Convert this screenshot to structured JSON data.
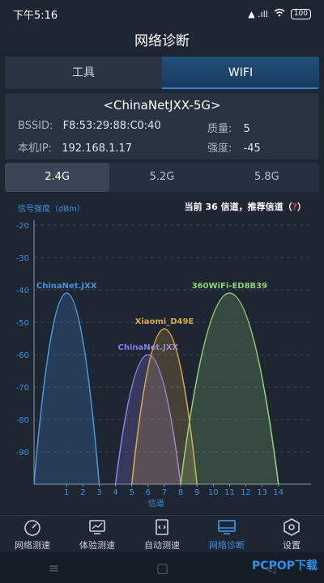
{
  "status_bar": {
    "time": "下午5:16",
    "signal": "▲ .ıll",
    "battery": "100"
  },
  "title": "网络诊断",
  "top_tabs": [
    "工具",
    "WIFI"
  ],
  "active_top_tab": 1,
  "network": {
    "ssid": "<ChinaNetJXX-5G>",
    "bssid_label": "BSSID:",
    "bssid": "F8:53:29:88:C0:40",
    "quality_label": "质量:",
    "quality": "5",
    "ip_label": "本机IP:",
    "ip": "192.168.1.17",
    "strength_label": "强度:",
    "strength": "-45"
  },
  "band_tabs": [
    "2.4G",
    "5.2G",
    "5.8G"
  ],
  "active_band": 0,
  "chart_header": {
    "ylabel": "信号强度（dBm）",
    "channel_info": "当前 36 信道，推荐信道（",
    "help": "?",
    "close_paren": "）"
  },
  "chart_data": {
    "type": "area",
    "xlabel": "信道",
    "ylabel": "信号强度（dBm）",
    "x_ticks": [
      1,
      2,
      3,
      4,
      5,
      6,
      7,
      8,
      9,
      10,
      11,
      12,
      13,
      14
    ],
    "y_ticks": [
      -20,
      -30,
      -40,
      -50,
      -60,
      -70,
      -80,
      -90
    ],
    "ylim": [
      -100,
      -20
    ],
    "series": [
      {
        "name": "ChinaNet.JXX",
        "channel": 1,
        "strength": -41,
        "span": 4,
        "color": "#4a8fd6"
      },
      {
        "name": "ChinaNet.JXX",
        "channel": 6,
        "strength": -60,
        "span": 4,
        "color": "#8b7bf0"
      },
      {
        "name": "Xiaomi_D49E",
        "channel": 7,
        "strength": -52,
        "span": 4,
        "color": "#d8a64a"
      },
      {
        "name": "360WiFi-ED8B39",
        "channel": 11,
        "strength": -41,
        "span": 6,
        "color": "#8fcf76"
      }
    ]
  },
  "bottom_nav": [
    "网络测速",
    "体验测速",
    "自动测速",
    "网络诊断",
    "设置"
  ],
  "active_nav": 3,
  "watermark": "PCPOP下载"
}
